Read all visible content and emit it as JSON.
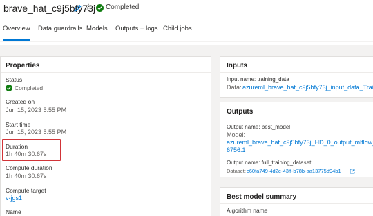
{
  "header": {
    "job_title": "brave_hat_c9j5bfy73j",
    "status": "Completed"
  },
  "tabs": [
    {
      "label": "Overview",
      "selected": true
    },
    {
      "label": "Data guardrails"
    },
    {
      "label": "Models"
    },
    {
      "label": "Outputs + logs"
    },
    {
      "label": "Child jobs"
    }
  ],
  "properties": {
    "title": "Properties",
    "status_label": "Status",
    "status_value": "Completed",
    "created_on_label": "Created on",
    "created_on_value": "Jun 15, 2023 5:55 PM",
    "start_time_label": "Start time",
    "start_time_value": "Jun 15, 2023 5:55 PM",
    "duration_label": "Duration",
    "duration_value": "1h 40m 30.67s",
    "compute_duration_label": "Compute duration",
    "compute_duration_value": "1h 40m 30.67s",
    "compute_target_label": "Compute target",
    "compute_target_value": "v-jgs1",
    "name_label": "Name"
  },
  "inputs": {
    "title": "Inputs",
    "input_name": "Input name: training_data",
    "data_prefix": "Data:",
    "data_link": "azureml_brave_hat_c9j5bfy73j_input_data_Traini"
  },
  "outputs": {
    "title": "Outputs",
    "output1_name": "Output name: best_model",
    "model_prefix": "Model:",
    "model_link_line1": "azureml_brave_hat_c9j5bfy73j_HD_0_output_mlflow_l",
    "model_link_line2": "6756:1",
    "output2_name": "Output name: full_training_dataset",
    "dataset_prefix": "Dataset:",
    "dataset_link": "c60fa749-4d2e-43ff-b78b-aa13775d94b1"
  },
  "best_model_summary": {
    "title": "Best model summary",
    "algorithm_label": "Algorithm name"
  },
  "colors": {
    "accent": "#0078d4",
    "success": "#107c10",
    "highlight": "#d13438"
  }
}
